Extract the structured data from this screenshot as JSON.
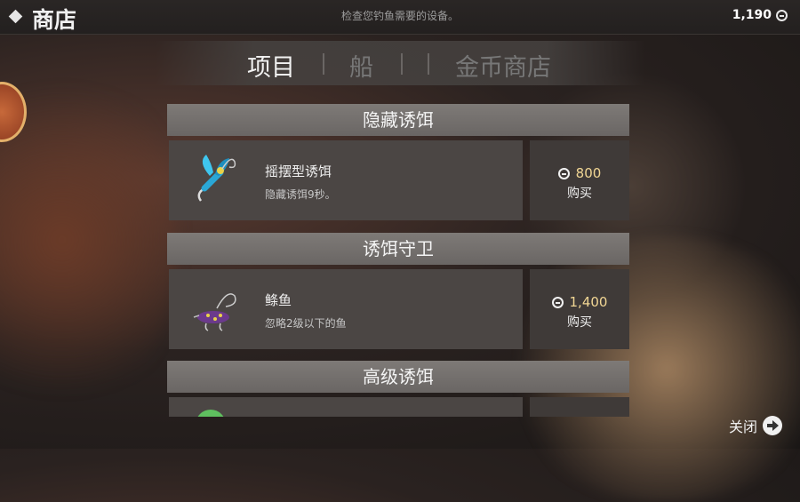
{
  "header": {
    "title": "商店",
    "subtitle": "检查您钓鱼需要的设备。",
    "coins": "1,190"
  },
  "tabs": [
    {
      "label": "项目",
      "active": true
    },
    {
      "label": "船",
      "active": false
    },
    {
      "label": "金币商店",
      "active": false
    }
  ],
  "sections": [
    {
      "title": "隐藏诱饵",
      "item": {
        "name": "摇摆型诱饵",
        "desc": "隐藏诱饵9秒。",
        "price": "800",
        "buy": "购买"
      }
    },
    {
      "title": "诱饵守卫",
      "item": {
        "name": "鲦鱼",
        "desc": "忽略2级以下的鱼",
        "price": "1,400",
        "buy": "购买"
      }
    },
    {
      "title": "高级诱饵"
    }
  ],
  "footer": {
    "close_label": "关闭"
  },
  "icons": {
    "currency": "coin-icon",
    "close": "arrow-right-circle-icon"
  }
}
